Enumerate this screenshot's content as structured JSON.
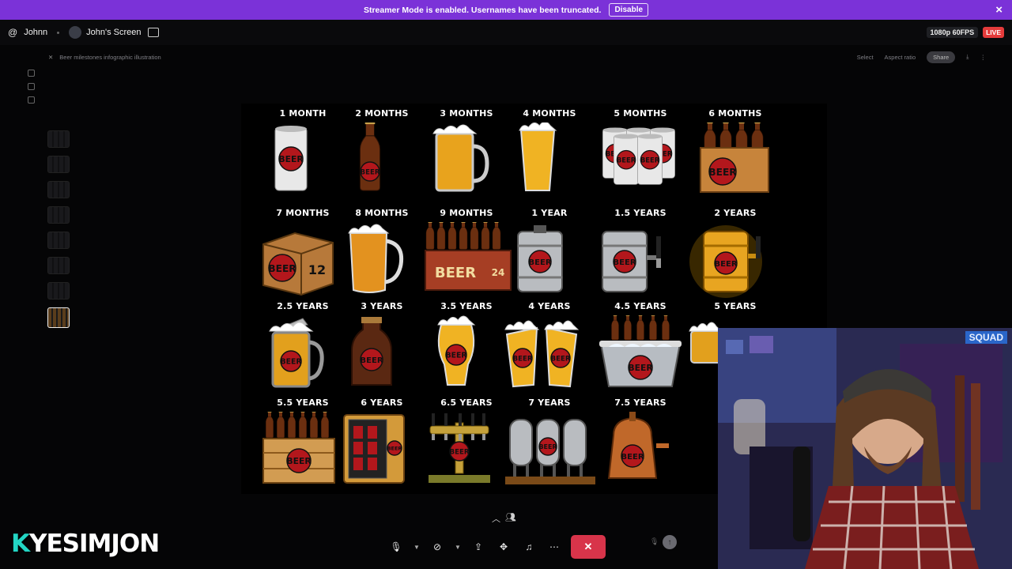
{
  "banner": {
    "message": "Streamer Mode is enabled. Usernames have been truncated.",
    "button": "Disable",
    "close": "×"
  },
  "stream": {
    "user": "Johnn",
    "screen": "John's Screen",
    "quality": "1080p 60FPS",
    "live": "LIVE"
  },
  "app": {
    "title": "Beer milestones infographic illustration",
    "select": "Select",
    "aspect": "Aspect ratio",
    "share": "Share"
  },
  "milestones": [
    {
      "label": "1 MONTH",
      "item": "can"
    },
    {
      "label": "2 MONTHS",
      "item": "bottle"
    },
    {
      "label": "3 MONTHS",
      "item": "mug"
    },
    {
      "label": "4 MONTHS",
      "item": "pint"
    },
    {
      "label": "5 MONTHS",
      "item": "six-cans"
    },
    {
      "label": "6 MONTHS",
      "item": "six-pack"
    },
    {
      "label": "7 MONTHS",
      "item": "box-12"
    },
    {
      "label": "8 MONTHS",
      "item": "pitcher"
    },
    {
      "label": "9 MONTHS",
      "item": "crate-24"
    },
    {
      "label": "1 YEAR",
      "item": "keg"
    },
    {
      "label": "1.5 YEARS",
      "item": "keg-tap"
    },
    {
      "label": "2 YEARS",
      "item": "gold-keg"
    },
    {
      "label": "2.5 YEARS",
      "item": "stein"
    },
    {
      "label": "3 YEARS",
      "item": "growler"
    },
    {
      "label": "3.5 YEARS",
      "item": "tulip"
    },
    {
      "label": "4 YEARS",
      "item": "two-pints"
    },
    {
      "label": "4.5 YEARS",
      "item": "bucket"
    },
    {
      "label": "5 YEARS",
      "item": "partial"
    },
    {
      "label": "5.5 YEARS",
      "item": "wood-crate"
    },
    {
      "label": "6 YEARS",
      "item": "fridge"
    },
    {
      "label": "6.5 YEARS",
      "item": "tap-tower"
    },
    {
      "label": "7 YEARS",
      "item": "brew-tanks"
    },
    {
      "label": "7.5 YEARS",
      "item": "copper-kettle"
    }
  ],
  "badge_text": "BEER",
  "pack12": "12",
  "pack24": "24",
  "webcam": {
    "sign": "SQUAD"
  },
  "watermark": {
    "k": "K",
    "name": "YESIMJON"
  },
  "colors": {
    "banner": "#7b32d8",
    "live": "#e53b3b",
    "end_call": "#d8344a",
    "badge_red": "#b3171c"
  }
}
